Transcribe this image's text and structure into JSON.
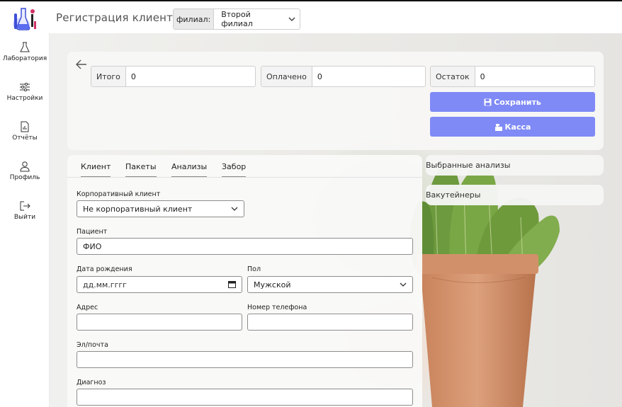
{
  "header": {
    "title": "Регистрация клиента",
    "branch_label": "филиал:",
    "branch_value": "Второй филиал"
  },
  "sidebar": {
    "items": [
      {
        "label": "Лаборатория",
        "icon": "flask-icon"
      },
      {
        "label": "Настройки",
        "icon": "sliders-icon"
      },
      {
        "label": "Отчёты",
        "icon": "report-icon"
      },
      {
        "label": "Профиль",
        "icon": "user-icon"
      },
      {
        "label": "Выйти",
        "icon": "logout-icon"
      }
    ]
  },
  "summary": {
    "total_label": "Итого",
    "total_value": "0",
    "paid_label": "Оплачено",
    "paid_value": "0",
    "balance_label": "Остаток",
    "balance_value": "0"
  },
  "actions": {
    "save_label": "Сохранить",
    "cash_label": "Касса"
  },
  "tabs": [
    "Клиент",
    "Пакеты",
    "Анализы",
    "Забор"
  ],
  "form": {
    "corporate_label": "Корпоративный клиент",
    "corporate_value": "Не корпоративный клиент",
    "patient_label": "Пациент",
    "patient_placeholder": "ФИО",
    "birth_label": "Дата рождения",
    "birth_placeholder": "дд.мм.гггг",
    "gender_label": "Пол",
    "gender_value": "Мужской",
    "address_label": "Адрес",
    "phone_label": "Номер телефона",
    "email_label": "Эл/почта",
    "diagnosis_label": "Диагноз"
  },
  "panels": {
    "selected_tests": "Выбранные анализы",
    "vacutainers": "Вакутейнеры"
  },
  "colors": {
    "accent": "#7f8af6",
    "background": "#ecebe8"
  }
}
